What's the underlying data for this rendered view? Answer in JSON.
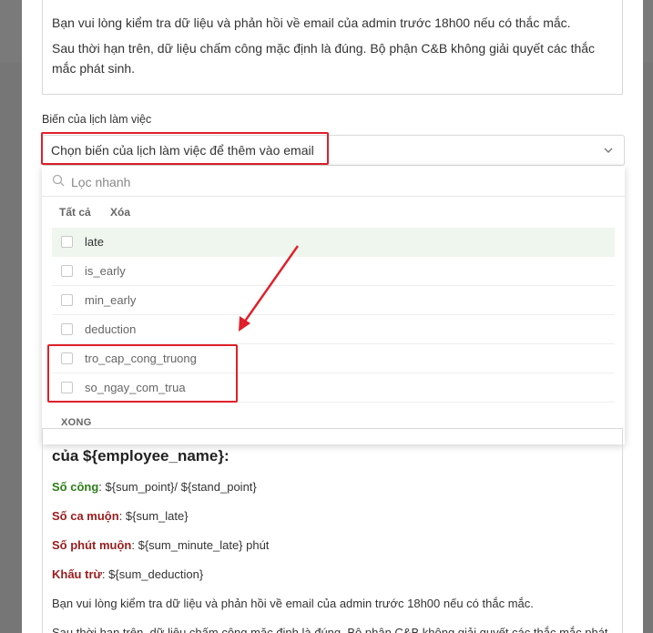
{
  "preview_top": {
    "line1": "Bạn vui lòng kiểm tra dữ liệu và phản hồi về email của admin trước 18h00 nếu có thắc mắc.",
    "line2": "Sau thời hạn trên, dữ liệu chấm công mặc định là đúng. Bộ phận C&B không giải quyết các thắc mắc phát sinh."
  },
  "field": {
    "label": "Biến của lịch làm việc",
    "placeholder": "Chọn biến của lịch làm việc để thêm vào email"
  },
  "dropdown": {
    "search_placeholder": "Lọc nhanh",
    "select_all": "Tất cả",
    "clear": "Xóa",
    "options": [
      "late",
      "is_early",
      "min_early",
      "deduction",
      "tro_cap_cong_truong",
      "so_ngay_com_trua"
    ],
    "done": "XONG"
  },
  "preview_bottom": {
    "heading_peek": "(truncated line partially hidden)",
    "heading": "của ${employee_name}:",
    "rows": [
      {
        "label": "Số công",
        "value": ": ${sum_point}/ ${stand_point}"
      },
      {
        "label": "Số ca muộn",
        "value": ": ${sum_late}"
      },
      {
        "label": "Số phút muộn",
        "value": ": ${sum_minute_late} phút"
      },
      {
        "label": "Khấu trừ",
        "value": ": ${sum_deduction}"
      }
    ],
    "footer1": "Bạn vui lòng kiểm tra dữ liệu và phản hồi về email của admin trước 18h00 nếu có thắc mắc.",
    "footer2": "Sau thời hạn trên, dữ liệu chấm công mặc định là đúng. Bộ phận C&B không giải quyết các thắc mắc phát"
  },
  "colors": {
    "highlight": "#e0202a",
    "accent_green": "#2e7d1a",
    "accent_red": "#9b1c1c"
  }
}
